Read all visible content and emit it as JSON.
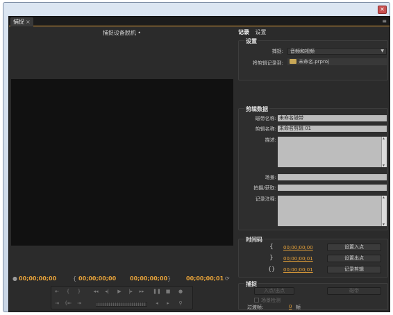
{
  "panel": {
    "tab_label": "捕捉",
    "tab_close": "×",
    "menu_icon": "≡"
  },
  "monitor": {
    "status": "捕捉设备脱机",
    "status_dot": "•",
    "timecodes": {
      "current": "00;00;00;00",
      "in": "00;00;00;00",
      "out": "00;00;00;00",
      "duration": "00;00;00;01"
    }
  },
  "right_tabs": [
    {
      "label": "记录"
    },
    {
      "label": "设置"
    }
  ],
  "setup": {
    "title": "设置",
    "capture_label": "捕捉:",
    "capture_value": "音频和视频",
    "log_to_label": "将剪辑记录到:",
    "log_to_value": "未命名.prproj"
  },
  "clip_data": {
    "title": "剪辑数据",
    "tape_label": "磁带名称:",
    "tape_value": "未命名磁带",
    "clip_label": "剪辑名称:",
    "clip_value": "未命名剪辑 01",
    "desc_label": "描述:",
    "scene_label": "场景:",
    "shot_label": "拍摄/获取:",
    "comment_label": "记录注释:"
  },
  "timecode": {
    "title": "时间码",
    "in_value": "00;00;00;00",
    "in_button": "设置入点",
    "out_value": "00;00;00;01",
    "out_button": "设置出点",
    "dur_value": "00;00;00;01",
    "log_button": "记录剪辑"
  },
  "capture": {
    "title": "捕捉",
    "inout_button": "入点/出点",
    "tape_button": "磁带",
    "scene_detect_label": "场景检测",
    "handles_label": "过渡帧:",
    "handles_value": "0",
    "handles_unit": "帧"
  },
  "colors": {
    "accent": "#e8a33a",
    "panel_bg": "#2b2b2b",
    "video_bg": "#111111"
  }
}
